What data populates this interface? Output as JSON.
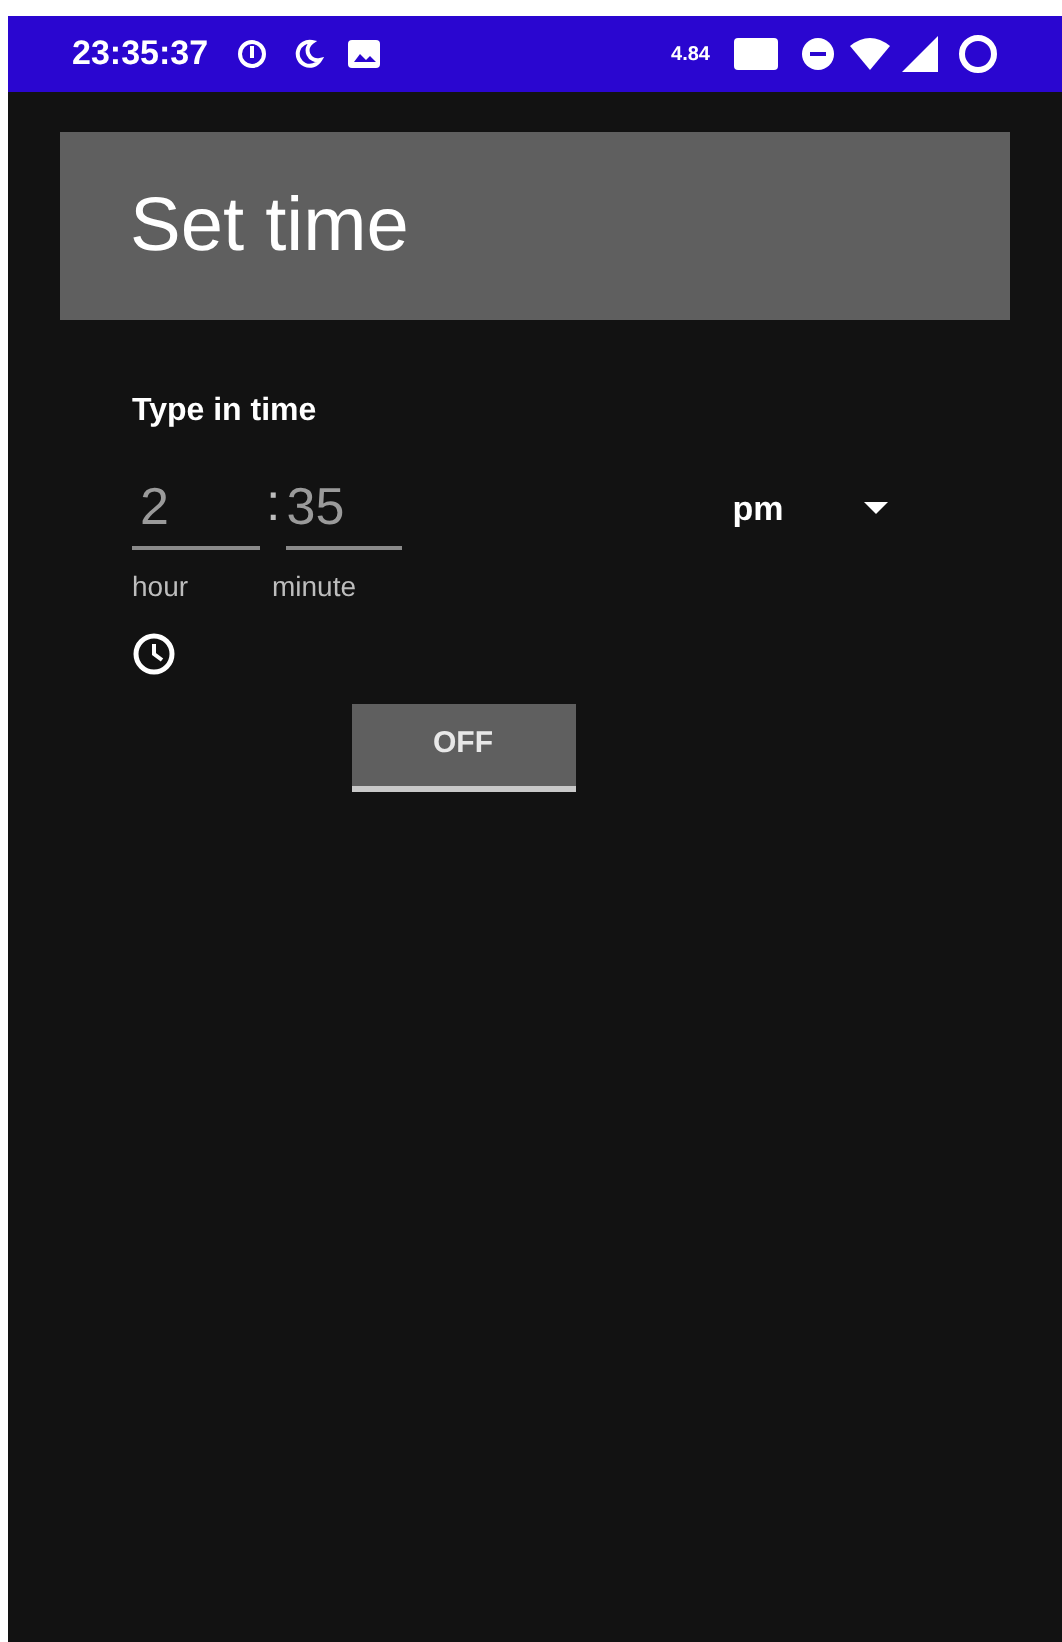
{
  "status_bar": {
    "time": "23:35:37",
    "net_speed": "4.84"
  },
  "title": "Set time",
  "section_label": "Type in time",
  "hour": {
    "value": "2",
    "label": "hour"
  },
  "separator": ":",
  "minute": {
    "value": "35",
    "label": "minute"
  },
  "period": {
    "value": "pm"
  },
  "toggle": {
    "label": "OFF",
    "on": false
  }
}
